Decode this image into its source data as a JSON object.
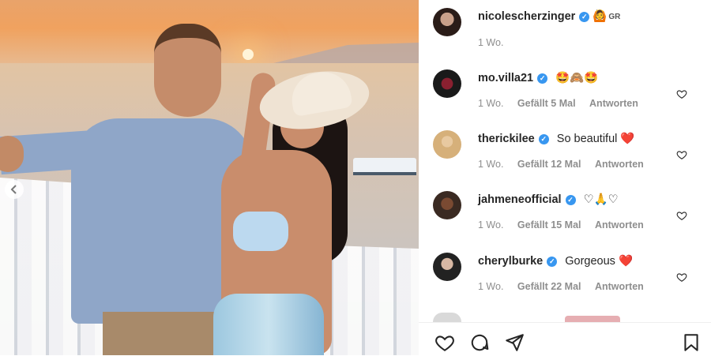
{
  "post": {
    "author": "nicolescherzinger",
    "author_flag": "GR",
    "time": "1 Wo."
  },
  "comments": [
    {
      "user": "mo.villa21",
      "text": "🤩🙈🤩",
      "time": "1 Wo.",
      "likes": "Gefällt 5 Mal",
      "reply": "Antworten"
    },
    {
      "user": "therickilee",
      "text": "So beautiful ❤️",
      "time": "1 Wo.",
      "likes": "Gefällt 12 Mal",
      "reply": "Antworten"
    },
    {
      "user": "jahmeneofficial",
      "text": "♡🙏♡",
      "time": "1 Wo.",
      "likes": "Gefällt 15 Mal",
      "reply": "Antworten"
    },
    {
      "user": "cherylburke",
      "text": "Gorgeous ❤️",
      "time": "1 Wo.",
      "likes": "Gefällt 22 Mal",
      "reply": "Antworten"
    }
  ],
  "colors": {
    "verified": "#3897f0",
    "meta": "#8e8e8e",
    "text": "#262626"
  },
  "icons": {
    "verified": "verified-badge-icon",
    "like": "heart-icon",
    "comment": "comment-bubble-icon",
    "share": "paper-plane-icon",
    "save": "bookmark-icon",
    "prev": "chevron-left-icon"
  }
}
